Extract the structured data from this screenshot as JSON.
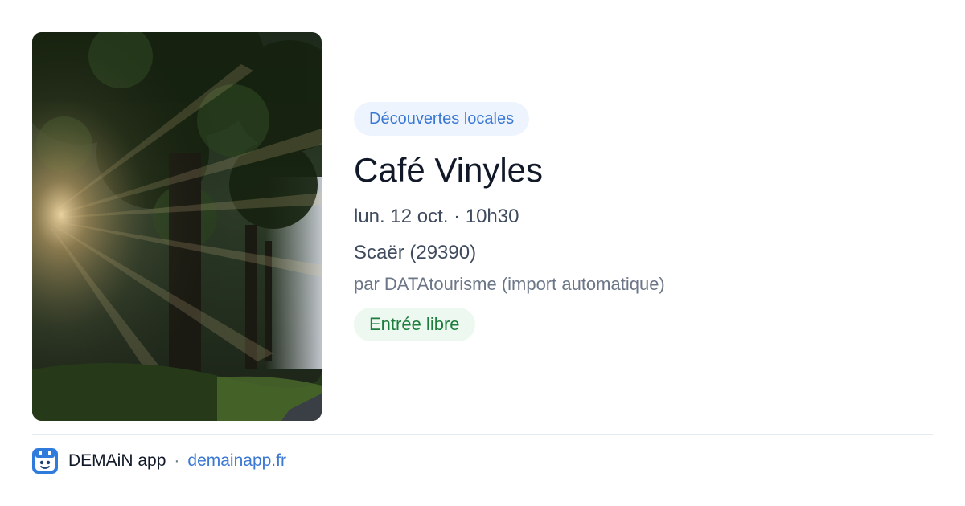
{
  "event": {
    "category": "Découvertes locales",
    "title": "Café Vinyles",
    "datetime": "lun. 12 oct. · 10h30",
    "location": "Scaër (29390)",
    "source": "par DATAtourisme (import automatique)",
    "price": "Entrée libre"
  },
  "footer": {
    "app_name": "DEMAiN app",
    "separator": "·",
    "site": "demainapp.fr"
  },
  "colors": {
    "category_bg": "#eef4fd",
    "category_text": "#3a78d4",
    "price_bg": "#edf8f0",
    "price_text": "#1c7d3c",
    "link": "#3a78d4"
  },
  "icons": {
    "app": "demain-app-icon"
  }
}
